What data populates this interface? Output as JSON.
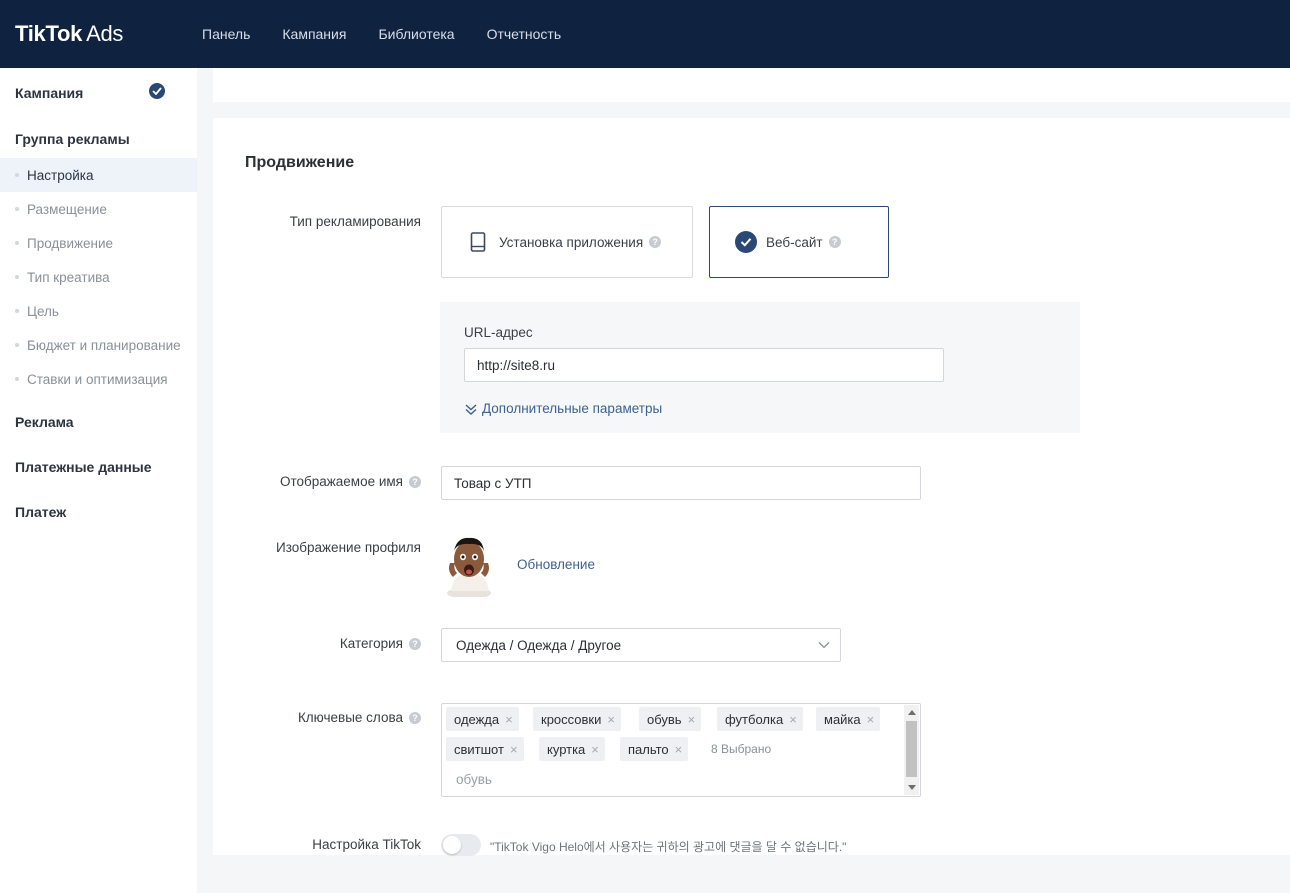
{
  "header": {
    "logo_main": "TikTok",
    "logo_sub": "Ads",
    "nav": [
      "Панель",
      "Кампания",
      "Библиотека",
      "Отчетность"
    ]
  },
  "sidebar": {
    "campaign": "Кампания",
    "ad_group": "Группа рекламы",
    "sub_items": [
      "Настройка",
      "Размещение",
      "Продвижение",
      "Тип креатива",
      "Цель",
      "Бюджет и планирование",
      "Ставки и оптимизация"
    ],
    "active_sub_index": 0,
    "ads": "Реклама",
    "billing": "Платежные данные",
    "payment": "Платеж"
  },
  "promotion": {
    "title": "Продвижение",
    "type_label": "Тип рекламирования",
    "option_app": "Установка приложения",
    "option_web": "Веб-сайт",
    "selected_option": "web",
    "url_label": "URL-адрес",
    "url_value": "http://site8.ru",
    "advanced": "Дополнительные параметры",
    "display_name_label": "Отображаемое имя",
    "display_name_value": "Товар с УТП",
    "profile_image_label": "Изображение профиля",
    "update_link": "Обновление",
    "category_label": "Категория",
    "category_value": "Одежда / Одежда / Другое",
    "keywords_label": "Ключевые слова",
    "keywords": [
      "одежда",
      "кроссовки",
      "обувь",
      "футболка",
      "майка",
      "свитшот",
      "куртка",
      "пальто"
    ],
    "selected_count": "8 Выбрано",
    "keyword_input": "обувь",
    "tiktok_setting_label": "Настройка TikTok",
    "tiktok_setting_note": "\"TikTok Vigo Helo에서 사용자는 귀하의 광고에 댓글을 달 수 없습니다.\"",
    "tiktok_setting_enabled": false
  },
  "colors": {
    "header_bg": "#0f2240",
    "accent": "#2a4875",
    "link": "#3e6191"
  }
}
